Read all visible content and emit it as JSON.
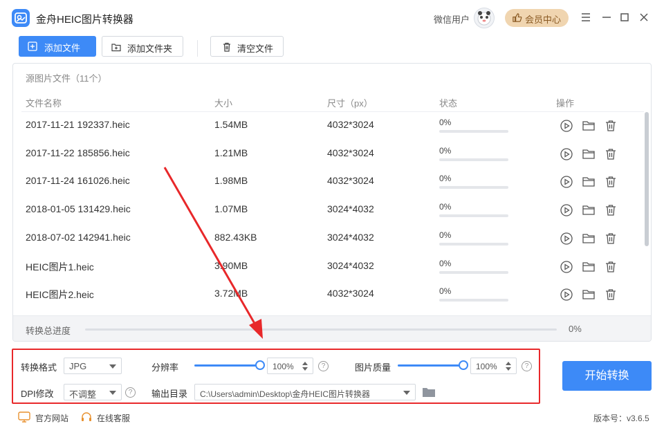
{
  "app": {
    "title": "金舟HEIC图片转换器",
    "user_label": "微信用户",
    "vip_label": "会员中心"
  },
  "toolbar": {
    "add_file": "添加文件",
    "add_folder": "添加文件夹",
    "clear_files": "清空文件"
  },
  "file_list": {
    "source_title": "源图片文件（11个）",
    "headers": {
      "name": "文件名称",
      "size": "大小",
      "dimensions": "尺寸（px）",
      "status": "状态",
      "actions": "操作"
    },
    "rows": [
      {
        "name": "2017-11-21 192337.heic",
        "size": "1.54MB",
        "dimensions": "4032*3024",
        "status": "0%",
        "progress": 0
      },
      {
        "name": "2017-11-22 185856.heic",
        "size": "1.21MB",
        "dimensions": "4032*3024",
        "status": "0%",
        "progress": 0
      },
      {
        "name": "2017-11-24 161026.heic",
        "size": "1.98MB",
        "dimensions": "4032*3024",
        "status": "0%",
        "progress": 0
      },
      {
        "name": "2018-01-05 131429.heic",
        "size": "1.07MB",
        "dimensions": "3024*4032",
        "status": "0%",
        "progress": 0
      },
      {
        "name": "2018-07-02 142941.heic",
        "size": "882.43KB",
        "dimensions": "3024*4032",
        "status": "0%",
        "progress": 0
      },
      {
        "name": "HEIC图片1.heic",
        "size": "3.90MB",
        "dimensions": "3024*4032",
        "status": "0%",
        "progress": 0
      },
      {
        "name": "HEIC图片2.heic",
        "size": "3.72MB",
        "dimensions": "4032*3024",
        "status": "0%",
        "progress": 0
      }
    ]
  },
  "overall_progress": {
    "label": "转换总进度",
    "percent_text": "0%",
    "value": 0
  },
  "settings": {
    "format_label": "转换格式",
    "format_value": "JPG",
    "resolution_label": "分辨率",
    "resolution_value": "100%",
    "resolution_level": 1.0,
    "quality_label": "图片质量",
    "quality_value": "100%",
    "quality_level": 1.0,
    "dpi_label": "DPI修改",
    "dpi_value": "不调整",
    "output_label": "输出目录",
    "output_path": "C:\\Users\\admin\\Desktop\\金舟HEIC图片转换器",
    "help_glyph": "?"
  },
  "start_button": "开始转换",
  "footer": {
    "website": "官方网站",
    "support": "在线客服",
    "version": "版本号：v3.6.5"
  },
  "colors": {
    "accent": "#3d8af7",
    "annotation": "#e8282a",
    "vip_bg": "#f0d5b0"
  }
}
